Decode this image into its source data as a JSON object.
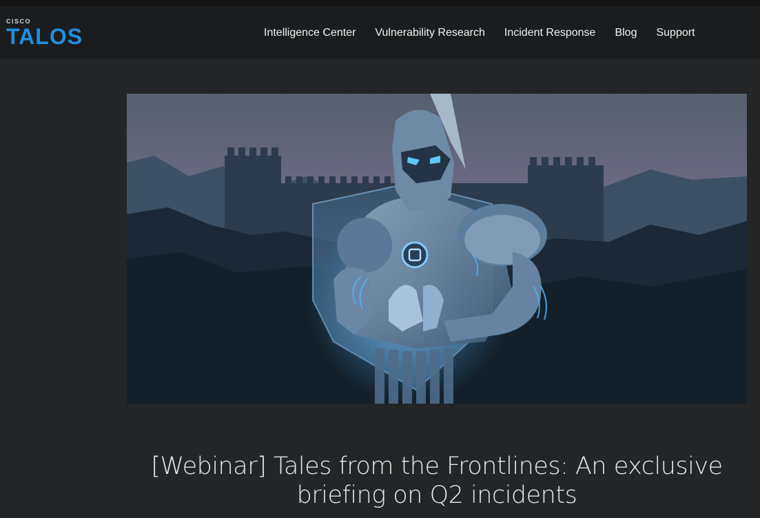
{
  "brand": {
    "small": "CISCO",
    "name": "TALOS",
    "color": "#1d8fe0"
  },
  "nav": {
    "items": [
      "Intelligence Center",
      "Vulnerability Research",
      "Incident Response",
      "Blog",
      "Support"
    ]
  },
  "hero": {
    "icon": "armored-knight-illustration"
  },
  "article": {
    "title": "[Webinar] Tales from the Frontlines: An exclusive briefing on Q2 incidents"
  }
}
